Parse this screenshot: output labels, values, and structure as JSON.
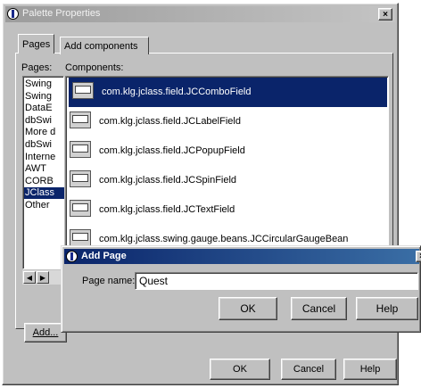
{
  "main_window": {
    "title": "Palette Properties",
    "close_label": "×"
  },
  "tabs": [
    {
      "label": "Pages"
    },
    {
      "label": "Add components"
    }
  ],
  "pages_label": "Pages:",
  "components_label": "Components:",
  "pages": [
    {
      "label": "Swing"
    },
    {
      "label": "Swing"
    },
    {
      "label": "DataE"
    },
    {
      "label": "dbSwi"
    },
    {
      "label": "More d"
    },
    {
      "label": "dbSwi"
    },
    {
      "label": "Interne"
    },
    {
      "label": "AWT"
    },
    {
      "label": "CORB"
    },
    {
      "label": "JClass",
      "selected": true
    },
    {
      "label": "Other"
    }
  ],
  "components": [
    {
      "label": "com.klg.jclass.field.JCComboField",
      "icon": "combo-field-icon",
      "selected": true
    },
    {
      "label": "com.klg.jclass.field.JCLabelField",
      "icon": "label-field-icon"
    },
    {
      "label": "com.klg.jclass.field.JCPopupField",
      "icon": "popup-field-icon"
    },
    {
      "label": "com.klg.jclass.field.JCSpinField",
      "icon": "spin-field-icon"
    },
    {
      "label": "com.klg.jclass.field.JCTextField",
      "icon": "text-field-icon"
    },
    {
      "label": "com.klg.jclass.swing.gauge.beans.JCCircularGaugeBean",
      "icon": "circular-gauge-icon"
    }
  ],
  "scroll": {
    "left": "◀",
    "right": "▶"
  },
  "bottom_buttons": {
    "add": "Add..."
  },
  "main_buttons": {
    "ok": "OK",
    "cancel": "Cancel",
    "help": "Help"
  },
  "add_page_dialog": {
    "title": "Add Page",
    "close_label": "×",
    "page_name_label": "Page name:",
    "page_name_value": "Quest",
    "ok": "OK",
    "cancel": "Cancel",
    "help": "Help"
  }
}
